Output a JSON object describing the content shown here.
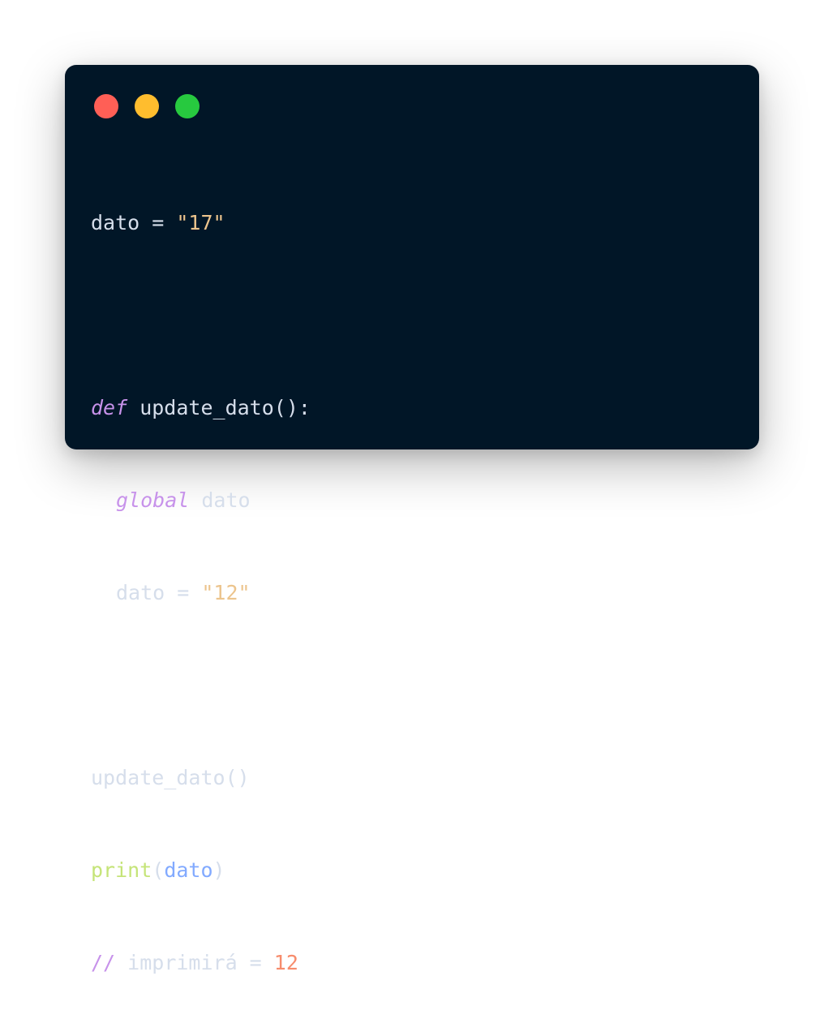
{
  "window": {
    "controls": [
      {
        "name": "close",
        "color": "#ff5f56"
      },
      {
        "name": "minimize",
        "color": "#ffbd2e"
      },
      {
        "name": "zoom",
        "color": "#27c93f"
      }
    ]
  },
  "code": {
    "line1": {
      "var": "dato",
      "op": " = ",
      "str": "\"17\""
    },
    "line3": {
      "kw": "def",
      "rest": " update_dato():"
    },
    "line4": {
      "kw": "global",
      "rest": " dato"
    },
    "line5": {
      "var": "dato",
      "op": " = ",
      "str": "\"12\""
    },
    "line7": {
      "text": "update_dato()"
    },
    "line8": {
      "fn": "print",
      "open": "(",
      "arg": "dato",
      "close": ")"
    },
    "line9": {
      "mark": "//",
      "text": " imprimirá = ",
      "num": "12"
    }
  }
}
